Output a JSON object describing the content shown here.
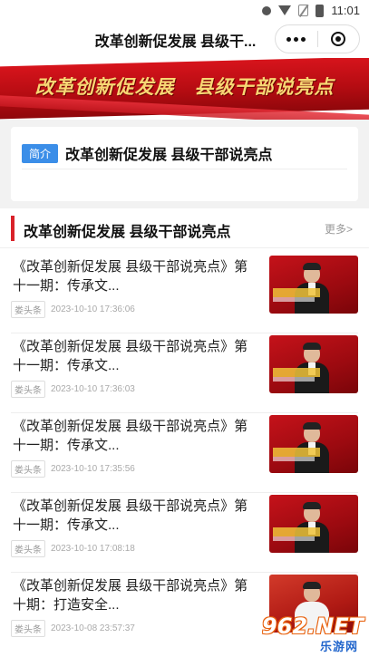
{
  "status_bar": {
    "time": "11:01"
  },
  "nav": {
    "title": "改革创新促发展 县级干..."
  },
  "banner": {
    "text": "改革创新促发展　县级干部说亮点"
  },
  "intro": {
    "badge": "简介",
    "title": "改革创新促发展 县级干部说亮点"
  },
  "section": {
    "title": "改革创新促发展 县级干部说亮点",
    "more": "更多>"
  },
  "articles": [
    {
      "title": "《改革创新促发展 县级干部说亮点》第十一期：传承文...",
      "source": "娄头条",
      "time": "2023-10-10 17:36:06"
    },
    {
      "title": "《改革创新促发展 县级干部说亮点》第十一期：传承文...",
      "source": "娄头条",
      "time": "2023-10-10 17:36:03"
    },
    {
      "title": "《改革创新促发展 县级干部说亮点》第十一期：传承文...",
      "source": "娄头条",
      "time": "2023-10-10 17:35:56"
    },
    {
      "title": "《改革创新促发展 县级干部说亮点》第十一期：传承文...",
      "source": "娄头条",
      "time": "2023-10-10 17:08:18"
    },
    {
      "title": "《改革创新促发展 县级干部说亮点》第十期：打造安全...",
      "source": "娄头条",
      "time": "2023-10-08 23:57:37"
    }
  ],
  "watermark": {
    "brand": "962.NET",
    "sub": "乐游网"
  },
  "colors": {
    "accent": "#d9222a",
    "badge": "#3b8ee8"
  }
}
